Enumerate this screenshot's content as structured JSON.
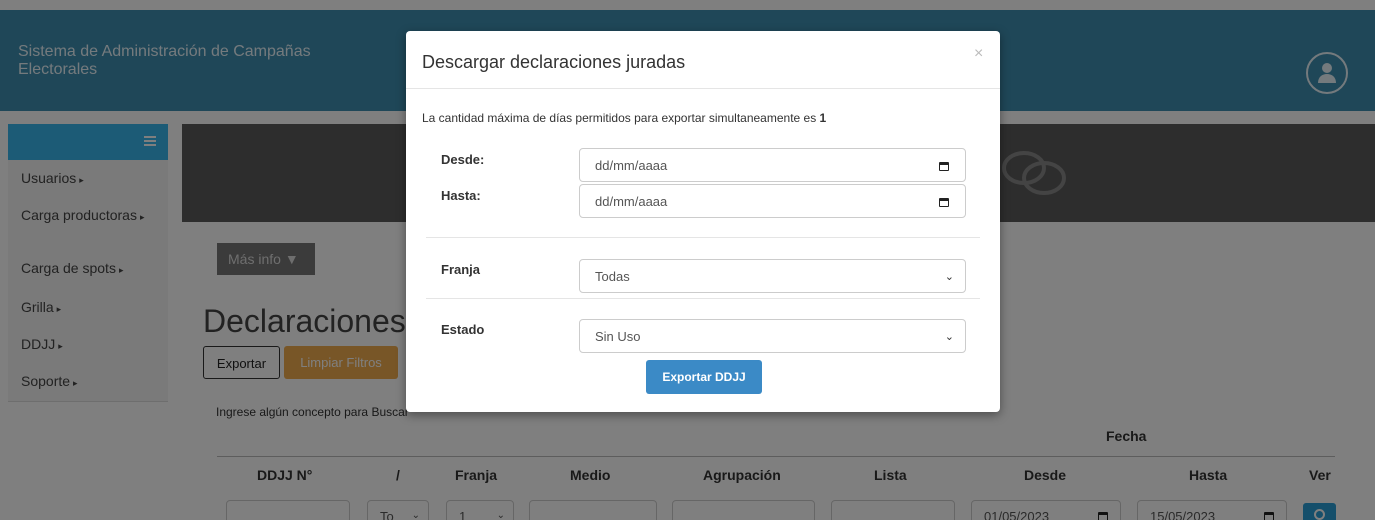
{
  "header": {
    "app_title": "Sistema de Administración de Campañas Electorales",
    "user_icon": "user-icon"
  },
  "sidebar": {
    "toggle_icon": "hamburger-icon",
    "items": [
      {
        "label": "Usuarios"
      },
      {
        "label": "Carga productoras"
      },
      {
        "label": "Carga de spots"
      },
      {
        "label": "Grilla"
      },
      {
        "label": "DDJJ"
      },
      {
        "label": "Soporte"
      }
    ]
  },
  "main": {
    "more_info": "Más info",
    "section_title": "Declaraciones juradas",
    "export_label": "Exportar",
    "clear_filters_label": "Limpiar Filtros",
    "search_hint": "Ingrese algún concepto para Buscar",
    "table": {
      "group_header": "Fecha",
      "columns": [
        "DDJJ N°",
        "/",
        "Franja",
        "Medio",
        "Agrupación",
        "Lista",
        "Desde",
        "Hasta",
        "Ver"
      ],
      "filters": {
        "tipo": "To",
        "franja": "1",
        "desde": "01/05/2023",
        "hasta": "15/05/2023"
      }
    }
  },
  "modal": {
    "title": "Descargar declaraciones juradas",
    "close_label": "×",
    "note_prefix": "La cantidad máxima de días permitidos para exportar simultaneamente es ",
    "note_value": "1",
    "desde_label": "Desde:",
    "desde_placeholder": "dd/mm/aaaa",
    "hasta_label": "Hasta:",
    "hasta_placeholder": "dd/mm/aaaa",
    "franja_label": "Franja",
    "franja_value": "Todas",
    "estado_label": "Estado",
    "estado_value": "Sin Uso",
    "submit_label": "Exportar DDJJ"
  },
  "colors": {
    "topbar": "#3e8fb1",
    "sidebar_head": "#39b6ec",
    "primary_button": "#3b8ac6",
    "warning_button": "#f0ad4e",
    "info_button": "#2a9fd6"
  }
}
